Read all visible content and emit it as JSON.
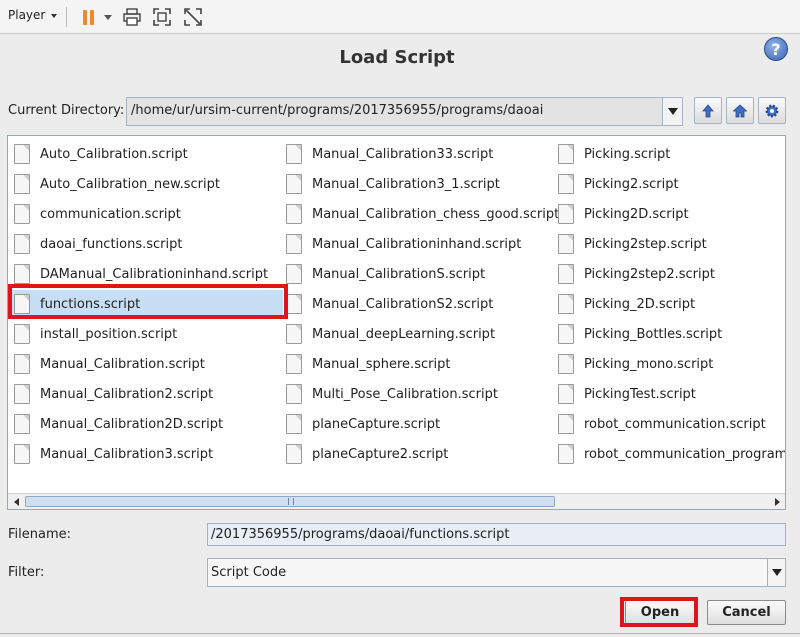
{
  "toolbar": {
    "player_label": "Player",
    "icons": [
      "pause-icon",
      "dropdown-caret-icon",
      "print-icon",
      "fullscreen-icon",
      "exit-fullscreen-icon"
    ]
  },
  "dialog": {
    "title": "Load Script",
    "current_directory_label": "Current Directory:",
    "current_directory": "/home/ur/ursim-current/programs/2017356955/programs/daoai",
    "filename_label": "Filename:",
    "filename_value": "/2017356955/programs/daoai/functions.script",
    "filter_label": "Filter:",
    "filter_value": "Script Code",
    "open_label": "Open",
    "cancel_label": "Cancel"
  },
  "files": {
    "selected": "functions.script",
    "col1": [
      "Auto_Calibration.script",
      "Auto_Calibration_new.script",
      "communication.script",
      "daoai_functions.script",
      "DAManual_Calibrationinhand.script",
      "functions.script",
      "install_position.script",
      "Manual_Calibration.script",
      "Manual_Calibration2.script",
      "Manual_Calibration2D.script",
      "Manual_Calibration3.script"
    ],
    "col2": [
      "Manual_Calibration33.script",
      "Manual_Calibration3_1.script",
      "Manual_Calibration_chess_good.script",
      "Manual_Calibrationinhand.script",
      "Manual_CalibrationS.script",
      "Manual_CalibrationS2.script",
      "Manual_deepLearning.script",
      "Manual_sphere.script",
      "Multi_Pose_Calibration.script",
      "planeCapture.script",
      "planeCapture2.script"
    ],
    "col3": [
      "Picking.script",
      "Picking2.script",
      "Picking2D.script",
      "Picking2step.script",
      "Picking2step2.script",
      "Picking_2D.script",
      "Picking_Bottles.script",
      "Picking_mono.script",
      "PickingTest.script",
      "robot_communication.script",
      "robot_communication_program.script"
    ]
  },
  "colors": {
    "accent_pause": "#f0892a",
    "selection": "#c7dff5",
    "highlight_red": "#e0141c"
  }
}
